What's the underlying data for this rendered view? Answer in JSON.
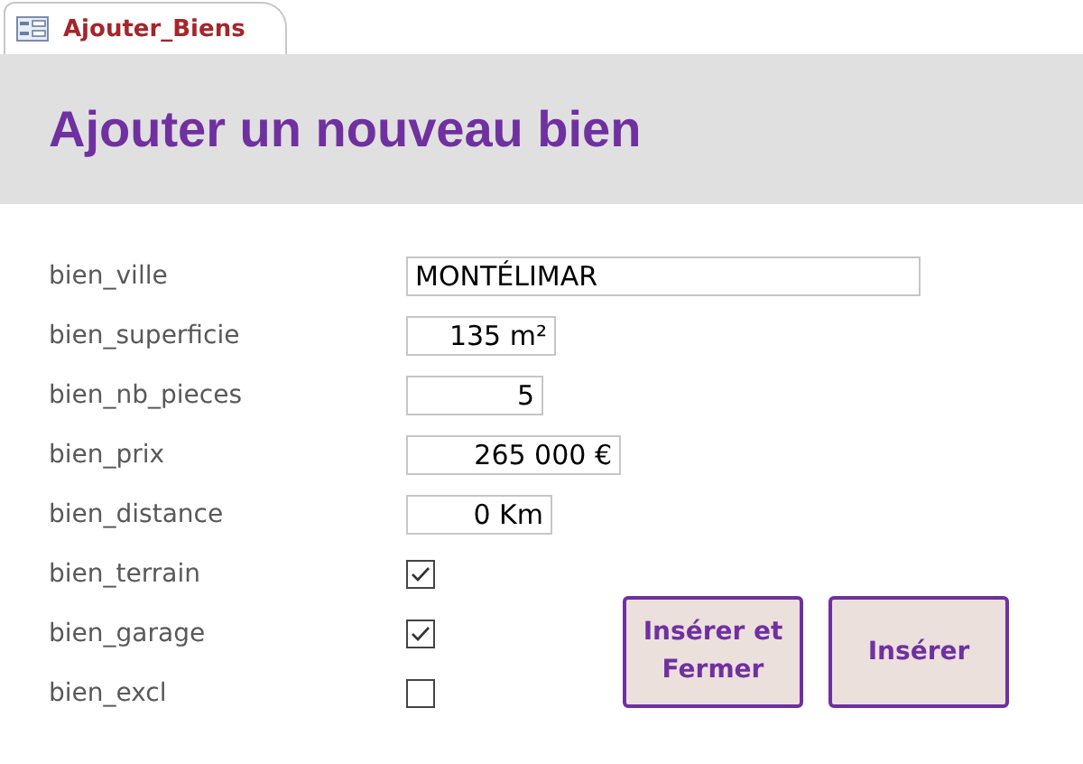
{
  "tab": {
    "title": "Ajouter_Biens",
    "selected": true
  },
  "header": {
    "title": "Ajouter un nouveau bien"
  },
  "fields": [
    {
      "label": "bien_ville",
      "kind": "text",
      "value": "MONTÉLIMAR"
    },
    {
      "label": "bien_superficie",
      "kind": "number",
      "value": "135 m²"
    },
    {
      "label": "bien_nb_pieces",
      "kind": "number",
      "value": "5"
    },
    {
      "label": "bien_prix",
      "kind": "number",
      "value": "265 000 €"
    },
    {
      "label": "bien_distance",
      "kind": "number",
      "value": "0 Km"
    },
    {
      "label": "bien_terrain",
      "kind": "checkbox",
      "checked": true
    },
    {
      "label": "bien_garage",
      "kind": "checkbox",
      "checked": true
    },
    {
      "label": "bien_excl",
      "kind": "checkbox",
      "checked": false
    }
  ],
  "buttons": [
    "Insérer et Fermer",
    "Insérer"
  ]
}
